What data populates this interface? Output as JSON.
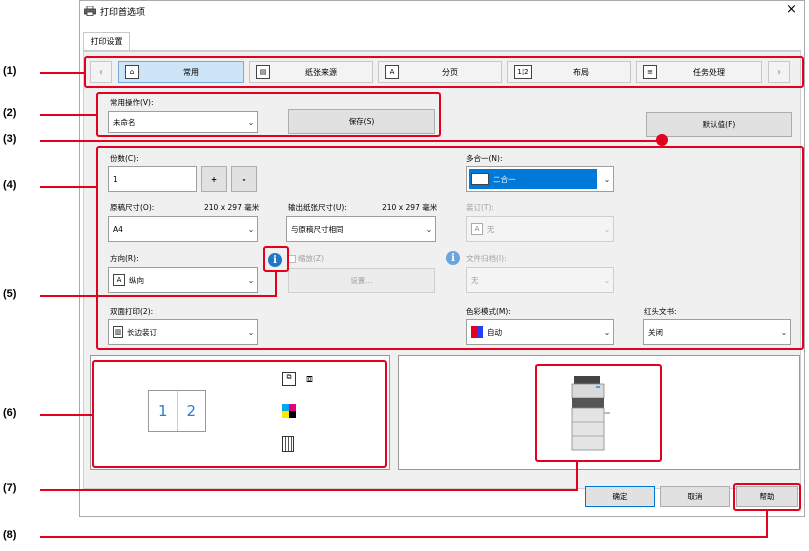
{
  "window": {
    "title": "打印首选项",
    "close_glyph": "×"
  },
  "tab": {
    "label": "打印设置"
  },
  "nav": {
    "prev": "‹",
    "next": "›",
    "items": [
      {
        "label": "常用",
        "icon": "home-icon",
        "glyph": "⌂"
      },
      {
        "label": "纸张来源",
        "icon": "paper-tray-icon",
        "glyph": "▤"
      },
      {
        "label": "分页",
        "icon": "page-icon",
        "glyph": "A"
      },
      {
        "label": "布局",
        "icon": "layout-icon",
        "glyph": "1¦2"
      },
      {
        "label": "任务处理",
        "icon": "job-handling-icon",
        "glyph": "≡"
      }
    ]
  },
  "favorites": {
    "label": "常用操作(V):",
    "value": "未命名",
    "save": "保存(S)"
  },
  "defaults_button": "默认值(F)",
  "copies": {
    "label": "份数(C):",
    "value": "1",
    "plus": "+",
    "minus": "-"
  },
  "original_size": {
    "label": "原稿尺寸(O):",
    "dims": "210 x 297 毫米",
    "value": "A4"
  },
  "output_size": {
    "label": "输出纸张尺寸(U):",
    "dims": "210 x 297 毫米",
    "value": "与原稿尺寸相同"
  },
  "orientation": {
    "label": "方向(R):",
    "value": "纵向"
  },
  "zoom": {
    "label": "缩放(Z)",
    "settings": "设置..."
  },
  "duplex": {
    "label": "双面打印(2):",
    "value": "长边装订"
  },
  "nup": {
    "label": "多合一(N):",
    "value": "二合一"
  },
  "binding": {
    "label": "装订(T):",
    "value": "无"
  },
  "retention": {
    "label": "文件归档(I):",
    "value": "无"
  },
  "color_mode": {
    "label": "色彩模式(M):",
    "value": "自动"
  },
  "header": {
    "label": "红头文书:",
    "value": "关闭"
  },
  "preview": {
    "page1": "1",
    "page2": "2"
  },
  "buttons": {
    "ok": "确定",
    "cancel": "取消",
    "help": "帮助"
  },
  "callouts": [
    "(1)",
    "(2)",
    "(3)",
    "(4)",
    "(5)",
    "(6)",
    "(7)",
    "(8)"
  ],
  "colors": {
    "callout_red": "#e6001f",
    "selection_blue": "#0078d7",
    "info_blue": "#1e78c8"
  }
}
